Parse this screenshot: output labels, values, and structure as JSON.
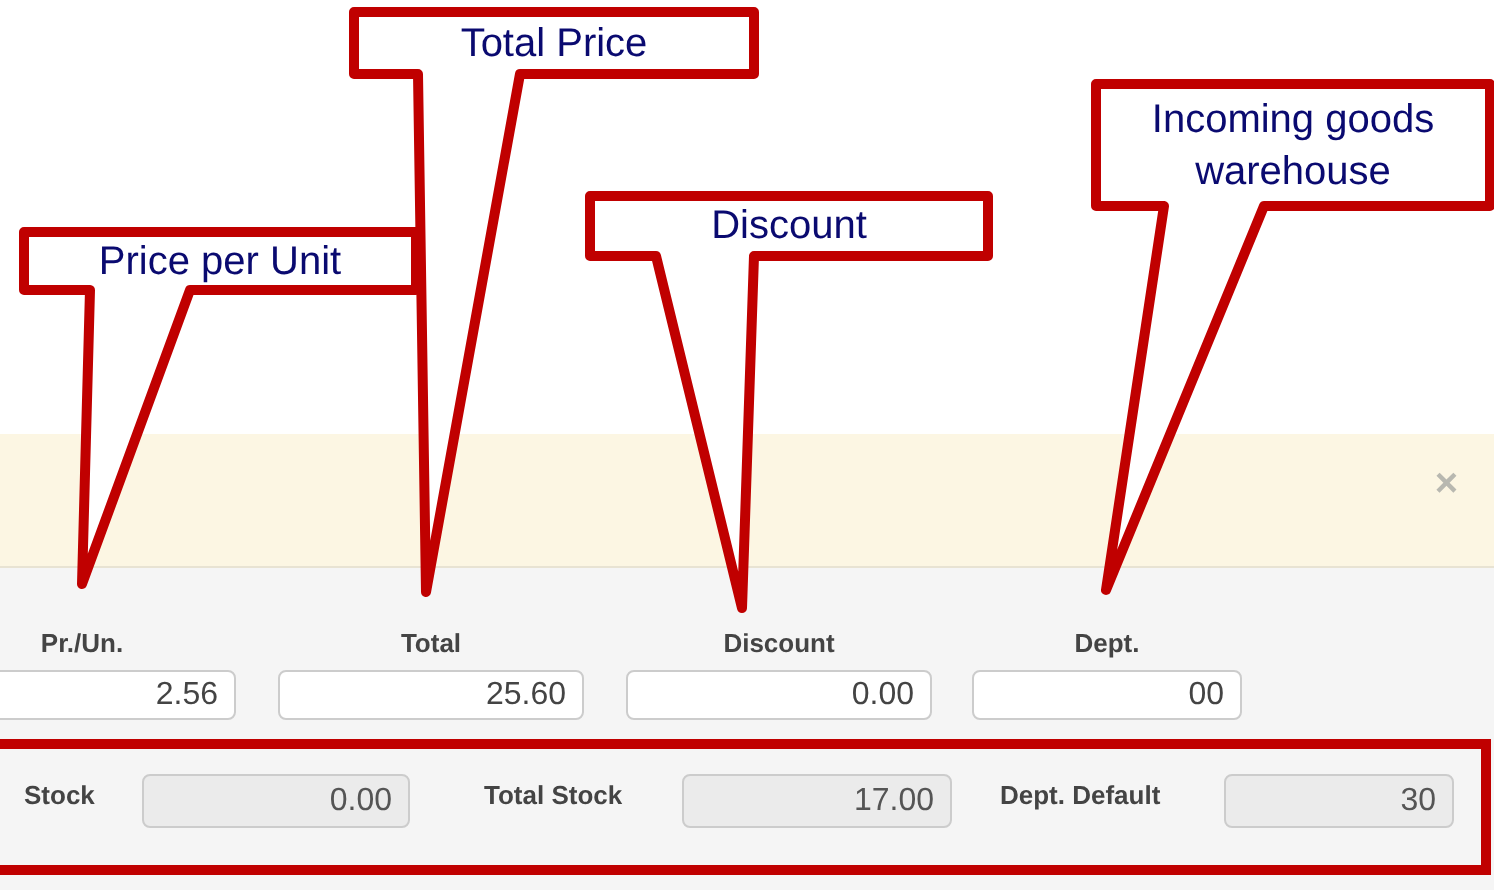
{
  "annotations": [
    {
      "text": "Price per Unit"
    },
    {
      "text": "Total Price"
    },
    {
      "text": "Discount"
    },
    {
      "text": "Incoming goods warehouse"
    }
  ],
  "notice": {
    "close": "×"
  },
  "columns": [
    {
      "label": "Pr./Un.",
      "value": "2.56",
      "disabled": false
    },
    {
      "label": "Total",
      "value": "25.60",
      "disabled": false
    },
    {
      "label": "Discount",
      "value": "0.00",
      "disabled": false
    },
    {
      "label": "Dept.",
      "value": "00",
      "disabled": false
    }
  ],
  "stock_fields": [
    {
      "label": "Stock",
      "value": "0.00",
      "disabled": true
    },
    {
      "label": "Total Stock",
      "value": "17.00",
      "disabled": true
    },
    {
      "label": "Dept. Default",
      "value": "30",
      "disabled": true
    }
  ]
}
